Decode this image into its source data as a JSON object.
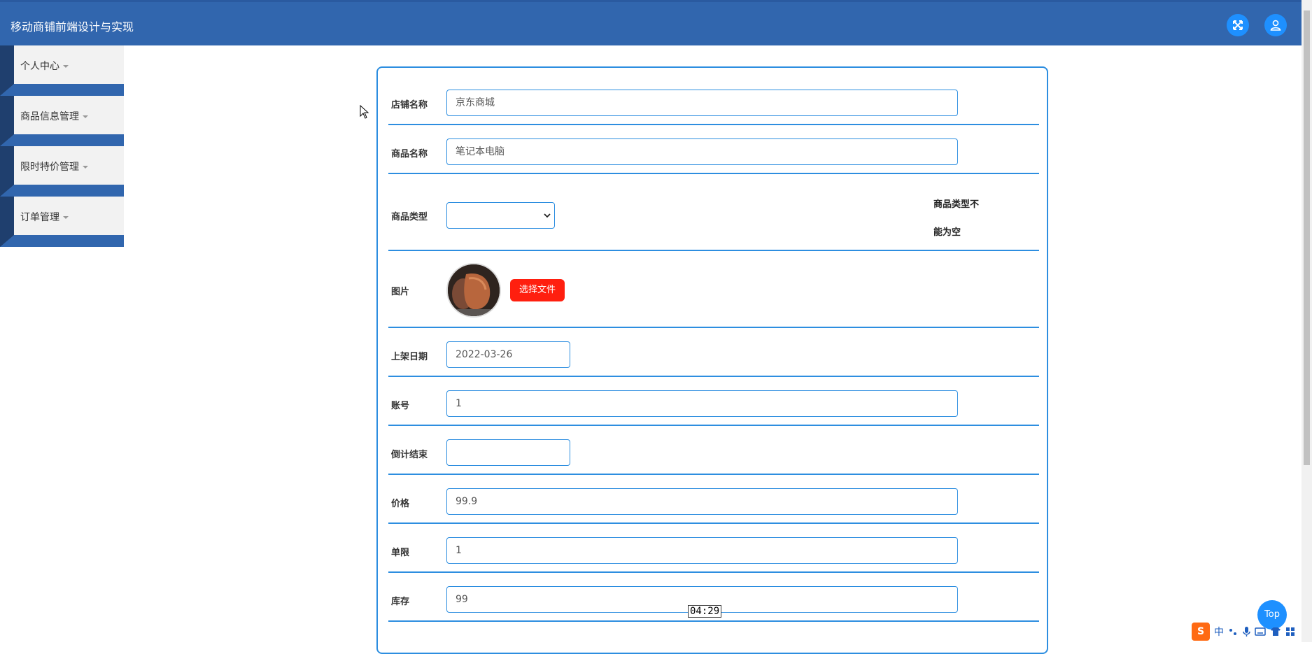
{
  "header": {
    "title": "移动商铺前端设计与实现"
  },
  "sidebar": {
    "items": [
      {
        "label": "个人中心"
      },
      {
        "label": "商品信息管理"
      },
      {
        "label": "限时特价管理"
      },
      {
        "label": "订单管理"
      }
    ]
  },
  "form": {
    "shop_name": {
      "label": "店铺名称",
      "value": "京东商城"
    },
    "product_name": {
      "label": "商品名称",
      "value": "笔记本电脑"
    },
    "product_type": {
      "label": "商品类型",
      "value": "",
      "error_line1": "商品类型不",
      "error_line2": "能为空"
    },
    "image": {
      "label": "图片",
      "button": "选择文件"
    },
    "listing_date": {
      "label": "上架日期",
      "value": "2022-03-26"
    },
    "account": {
      "label": "账号",
      "value": "1"
    },
    "countdown_end": {
      "label": "倒计结束",
      "value": ""
    },
    "price": {
      "label": "价格",
      "value": "99.9"
    },
    "limit": {
      "label": "单限",
      "value": "1"
    },
    "stock": {
      "label": "库存",
      "value": "99"
    }
  },
  "overlay": {
    "top_button": "Top",
    "timer": "04:29",
    "ime_label": "中"
  },
  "colors": {
    "header": "#3166ae",
    "accent": "#2d8ee0",
    "file_button": "#ff1f0f",
    "icon_button": "#1e90ff"
  },
  "icons": [
    "fullscreen-icon",
    "user-icon",
    "chevron-down-icon",
    "sogou-ime-icon"
  ]
}
